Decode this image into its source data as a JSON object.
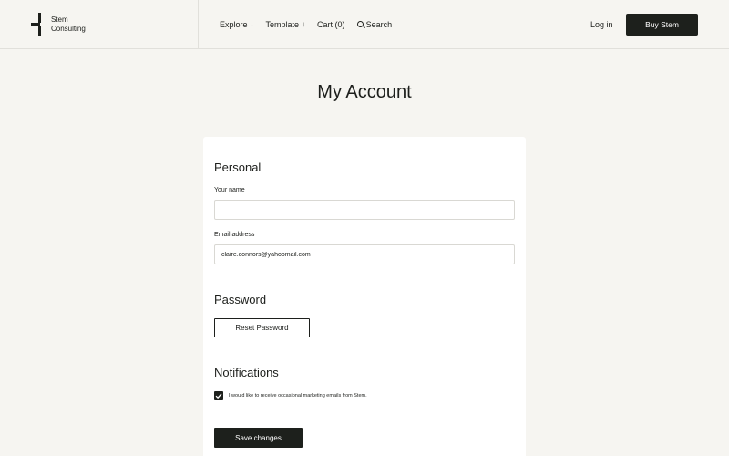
{
  "brand": {
    "line1": "Stem",
    "line2": "Consulting"
  },
  "nav": {
    "explore": "Explore",
    "template": "Template",
    "cart": "Cart (0)",
    "search": "Search",
    "arrow": "↓"
  },
  "header": {
    "login": "Log in",
    "buy": "Buy Stem"
  },
  "page": {
    "title": "My Account"
  },
  "personal": {
    "title": "Personal",
    "name_label": "Your name",
    "name_value": "",
    "email_label": "Email address",
    "email_value": "claire.connors@yahoomail.com"
  },
  "password": {
    "title": "Password",
    "reset_label": "Reset Password"
  },
  "notifications": {
    "title": "Notifications",
    "checked": true,
    "marketing_label": "I would like to receive occasional marketing emails from Stem."
  },
  "actions": {
    "save_label": "Save changes"
  }
}
